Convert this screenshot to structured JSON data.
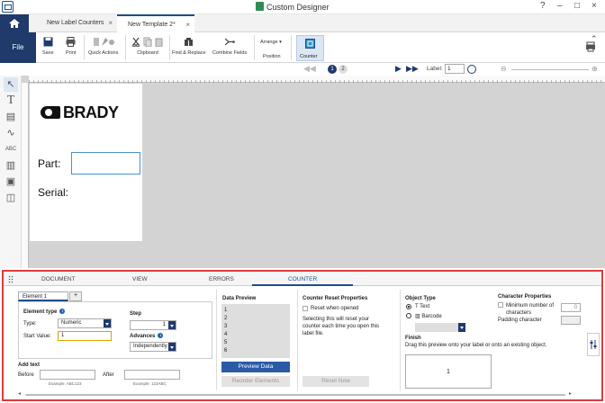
{
  "window": {
    "title": "Custom Designer",
    "controls": [
      "?",
      "–",
      "□",
      "×"
    ]
  },
  "tabs": [
    {
      "label": "New Label Counters",
      "active": false
    },
    {
      "label": "New Template 2*",
      "active": true
    }
  ],
  "ribbon": {
    "file": "File",
    "save": "Save",
    "print": "Print",
    "quick_actions": "Quick Actions",
    "clipboard": "Clipboard",
    "find_replace": "Find & Replace",
    "combine_fields": "Combine Fields",
    "arrange": "Arrange",
    "position": "Position",
    "counter": "Counter"
  },
  "nav": {
    "pages": [
      "1",
      "2"
    ],
    "label_prefix": "Label:",
    "label_value": "1"
  },
  "canvas": {
    "logo": "BRADY",
    "part_label": "Part:",
    "serial_label": "Serial:"
  },
  "panel": {
    "tabs": [
      "DOCUMENT",
      "VIEW",
      "ERRORS",
      "COUNTER"
    ],
    "element_tab": "Element 1",
    "add_tab": "+",
    "element_type_heading": "Element type",
    "type_label": "Type:",
    "type_value": "Numeric",
    "start_value_label": "Start Value:",
    "start_value": "1",
    "step_heading": "Step",
    "step_value": "1",
    "advances_heading": "Advances",
    "advances_value": "Independently",
    "add_text_heading": "Add text",
    "before_label": "Before",
    "before_example": "Example: ABC123",
    "after_label": "After",
    "after_example": "Example: 123ABC",
    "data_preview_heading": "Data Preview",
    "preview_values": [
      "1",
      "2",
      "3",
      "4",
      "5",
      "6"
    ],
    "preview_button": "Preview Data",
    "reorder_button": "Reorder Elements",
    "reset_heading": "Counter Reset Properties",
    "reset_checkbox": "Reset when opened",
    "reset_desc": "Selecting this will reset your counter each time you open this label file.",
    "reset_button": "Reset Now",
    "object_type_heading": "Object Type",
    "text_option": "Text",
    "barcode_option": "Barcode",
    "finish_heading": "Finish",
    "finish_desc": "Drag this preview onto your label or onto an existing object.",
    "finish_preview": "1",
    "char_props_heading": "Character Properties",
    "min_chars_label": "Minimum number of characters",
    "min_chars_value": "0",
    "padding_label": "Padding character"
  },
  "colors": {
    "accent": "#1f3a6b",
    "highlight_border": "#e03c3c",
    "button_blue": "#2b5aa7"
  }
}
